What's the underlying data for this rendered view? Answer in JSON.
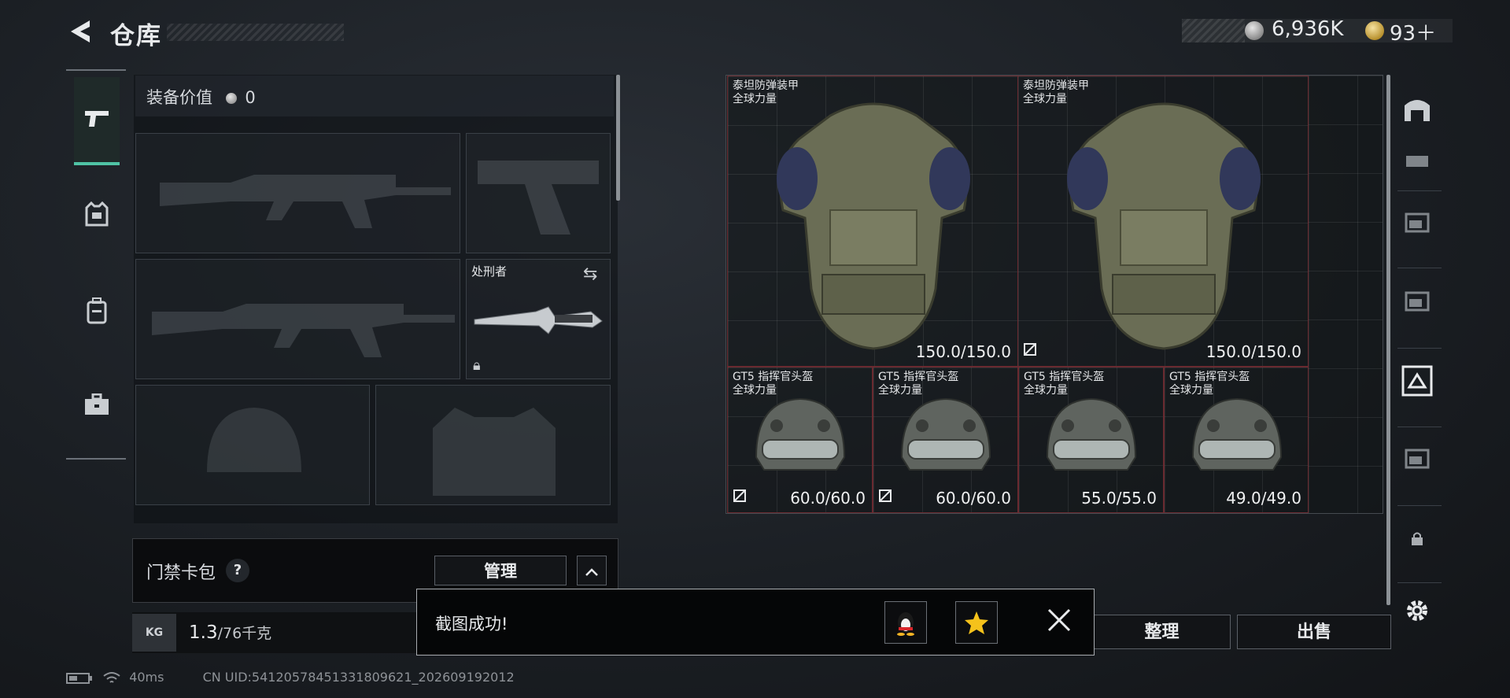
{
  "header": {
    "title": "仓库",
    "currency_silver": "6,936K",
    "currency_gold": "93＋"
  },
  "loadout": {
    "equip_value_label": "装备价值",
    "equip_value": "0",
    "melee_name": "处刑者"
  },
  "card_pack": {
    "label": "门禁卡包",
    "help": "?",
    "manage_label": "管理"
  },
  "weight": {
    "icon_label": "KG",
    "current": "1.3",
    "max": "/76千克"
  },
  "stash_items": [
    {
      "name": "泰坦防弹装甲",
      "sub": "全球力量",
      "durability": "150.0/150.0"
    },
    {
      "name": "泰坦防弹装甲",
      "sub": "全球力量",
      "durability": "150.0/150.0"
    },
    {
      "name": "GT5 指挥官头盔",
      "sub": "全球力量",
      "durability": "60.0/60.0"
    },
    {
      "name": "GT5 指挥官头盔",
      "sub": "全球力量",
      "durability": "60.0/60.0"
    },
    {
      "name": "GT5 指挥官头盔",
      "sub": "全球力量",
      "durability": "55.0/55.0"
    },
    {
      "name": "GT5 指挥官头盔",
      "sub": "全球力量",
      "durability": "49.0/49.0"
    }
  ],
  "actions": {
    "sort_label": "整理",
    "sell_label": "出售"
  },
  "toast": {
    "message": "截图成功!"
  },
  "status_bar": {
    "ping": "40ms",
    "uid": "CN UID:5412057845133180​9621_202609192012"
  },
  "colors": {
    "accent": "#4fc3a5",
    "item_bg_red": "#5b1d23"
  }
}
